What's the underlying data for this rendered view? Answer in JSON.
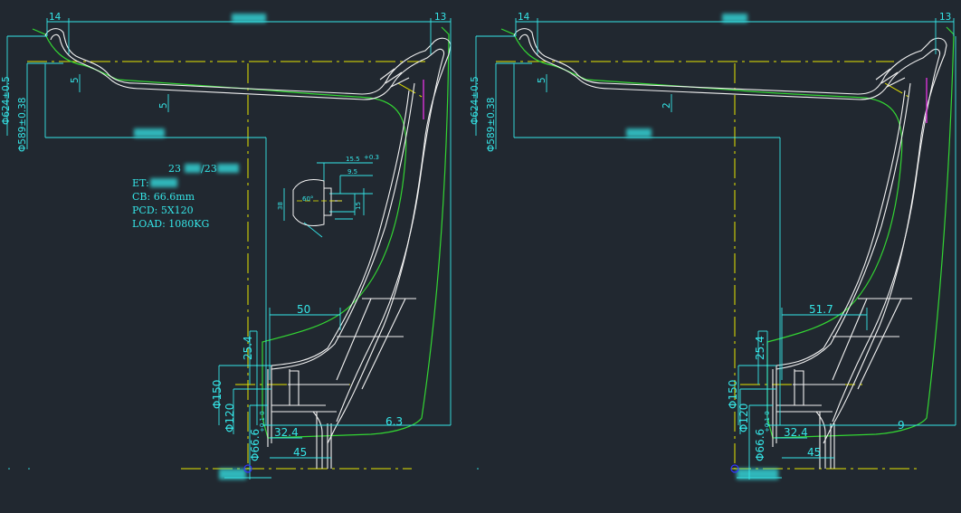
{
  "colors": {
    "background": "#212830",
    "dimension": "#35e6e8",
    "profile": "#f2f2f2",
    "outline": "#33d633",
    "centerline": "#e6e600",
    "marker": "#cc33cc",
    "origin": "#3333ff"
  },
  "left_drawing": {
    "dim_top_left": "14",
    "dim_top_right": "13",
    "dia_outer": "Φ624±0.5",
    "dia_seat": "Φ589±0.38",
    "thick_a": "5",
    "thick_b": "5",
    "flange_offset": "50",
    "hub_depth": "25.4",
    "dia_150": "Φ150",
    "dia_120": "Φ120",
    "dia_bore": "Φ66.6",
    "bore_tol": "+0.1 0",
    "bolt_seat": "32.4",
    "hub_width": "45",
    "rim_edge": "6.3",
    "spec_size": "23",
    "spec_et": "ET:",
    "spec_cb": "CB: 66.6mm",
    "spec_pcd": "PCD: 5X120",
    "spec_load": "LOAD:  1080KG",
    "detail_155": "15.5",
    "detail_95": "9.5",
    "detail_38": "38",
    "detail_15": "15",
    "detail_angle": "60°",
    "detail_tol": "+0.3"
  },
  "right_drawing": {
    "dim_top_left": "14",
    "dim_top_right": "13",
    "dia_outer": "Φ624±0.5",
    "dia_seat": "Φ589±0.38",
    "thick_a": "5",
    "thick_b": "2",
    "flange_offset": "51.7",
    "hub_depth": "25.4",
    "dia_150": "Φ150",
    "dia_120": "Φ120",
    "dia_bore": "Φ66.6",
    "bore_tol": "+0.1 0",
    "bolt_seat": "32.4",
    "hub_width": "45",
    "rim_edge": "9"
  }
}
